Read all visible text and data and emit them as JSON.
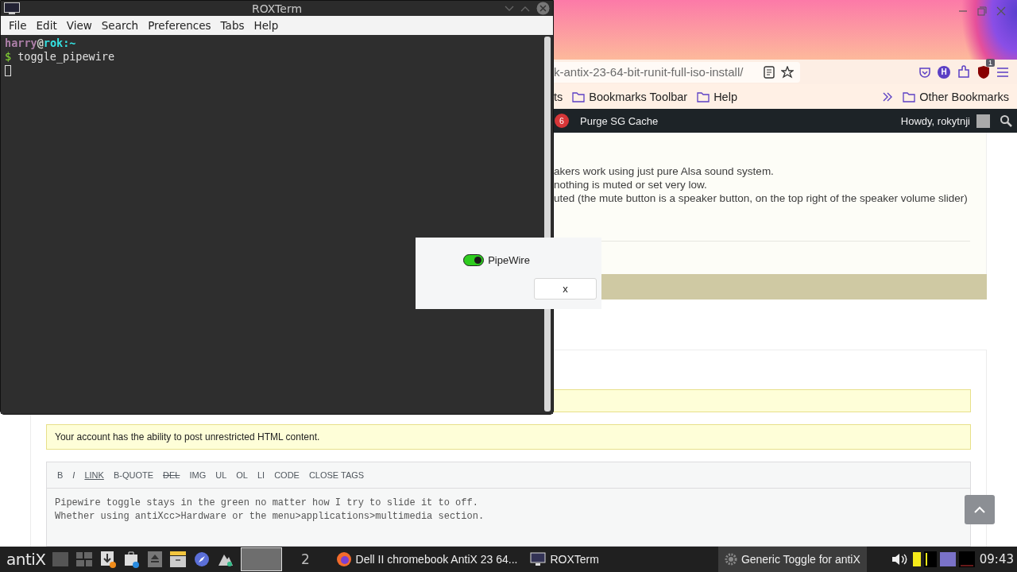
{
  "browser": {
    "url": "k-antix-23-64-bit-runit-full-iso-install/",
    "toolbar_badge": "1",
    "account_initial": "H",
    "bookmarks": [
      {
        "label": "ts",
        "folder": false
      },
      {
        "label": "Bookmarks Toolbar",
        "folder": true
      },
      {
        "label": "Help",
        "folder": true
      }
    ],
    "other_bookmarks": "Other Bookmarks",
    "admin_bar": {
      "count": "6",
      "purge": "Purge SG Cache",
      "greeting": "Howdy, rokytnji"
    },
    "post_lines": [
      "akers work using just pure Alsa sound system.",
      "nothing is muted or set very low.",
      "uted (the mute button is a speaker button, on the top right of the speaker volume slider)"
    ],
    "notice": "Your account has the ability to post unrestricted HTML content.",
    "editor_buttons": [
      {
        "label": "B",
        "kind": "plain"
      },
      {
        "label": "I",
        "kind": "italic"
      },
      {
        "label": "LINK",
        "kind": "underline"
      },
      {
        "label": "B-QUOTE",
        "kind": "plain"
      },
      {
        "label": "DEL",
        "kind": "strike"
      },
      {
        "label": "IMG",
        "kind": "plain"
      },
      {
        "label": "UL",
        "kind": "plain"
      },
      {
        "label": "OL",
        "kind": "plain"
      },
      {
        "label": "LI",
        "kind": "plain"
      },
      {
        "label": "CODE",
        "kind": "plain"
      },
      {
        "label": "CLOSE TAGS",
        "kind": "plain"
      }
    ],
    "editor_text": [
      "Pipewire toggle stays in the green no matter how I try to slide it to off.",
      "Whether using antiXcc>Hardware or the menu>applications>multimedia section."
    ]
  },
  "terminal": {
    "title": "ROXTerm",
    "menu": [
      "File",
      "Edit",
      "View",
      "Search",
      "Preferences",
      "Tabs",
      "Help"
    ],
    "prompt_segments": [
      {
        "text": "harry",
        "color": "#ad7fa8"
      },
      {
        "text": "@",
        "color": "#d3d7cf"
      },
      {
        "text": "rok",
        "color": "#34e2e2"
      },
      {
        "text": ":~",
        "color": "#34e2e2"
      }
    ],
    "command_line": {
      "prompt": "$",
      "command": "toggle_pipewire"
    }
  },
  "dialog": {
    "toggle": {
      "label": "PipeWire",
      "on": true
    },
    "button": "x"
  },
  "taskbar": {
    "logo": "antiX",
    "workspaces": [
      {
        "selected": true
      },
      {
        "label": "2",
        "selected": false
      }
    ],
    "tasks": [
      {
        "label": "Dell II chromebook AntiX 23 64...",
        "kind": "firefox",
        "selected": false
      },
      {
        "label": "ROXTerm",
        "kind": "terminal",
        "selected": false
      },
      {
        "label": "Generic Toggle for antiX",
        "kind": "gear",
        "selected": true
      }
    ],
    "clock": "09:43"
  }
}
